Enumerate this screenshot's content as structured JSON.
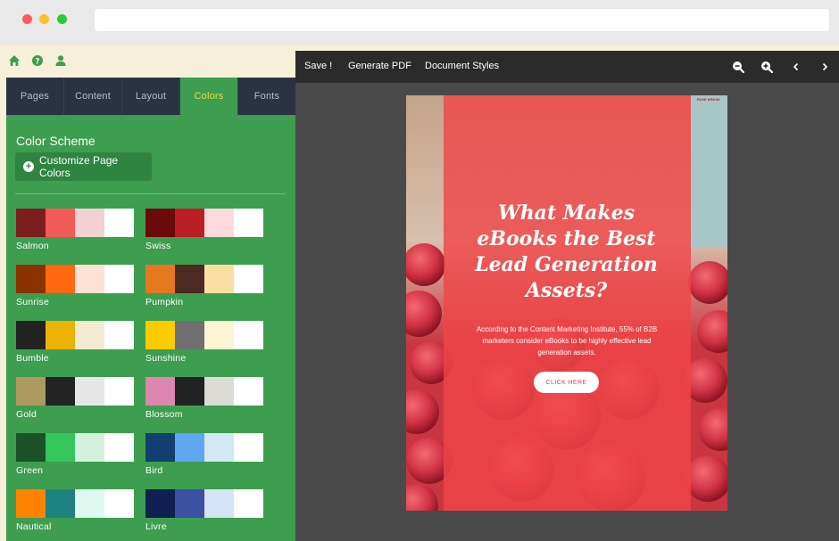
{
  "nav_icons": [
    "home-icon",
    "help-icon",
    "user-icon"
  ],
  "tabs": [
    {
      "label": "Pages"
    },
    {
      "label": "Content"
    },
    {
      "label": "Layout"
    },
    {
      "label": "Colors"
    },
    {
      "label": "Fonts"
    }
  ],
  "active_tab": "Colors",
  "panel": {
    "title": "Color Scheme",
    "customize_label": "Customize Page Colors"
  },
  "schemes": [
    {
      "name": "Salmon",
      "colors": [
        "#7d1e1e",
        "#f25a57",
        "#f1d1d1",
        "#ffffff"
      ]
    },
    {
      "name": "Swiss",
      "colors": [
        "#6b0a0a",
        "#ba1f26",
        "#fcd9dc",
        "#ffffff"
      ]
    },
    {
      "name": "Sunrise",
      "colors": [
        "#8a3200",
        "#ff6a10",
        "#fde1d3",
        "#ffffff"
      ]
    },
    {
      "name": "Pumpkin",
      "colors": [
        "#e5771e",
        "#4a2a22",
        "#fadfa4",
        "#ffffff"
      ]
    },
    {
      "name": "Bumble",
      "colors": [
        "#222222",
        "#eab305",
        "#f3ebcf",
        "#ffffff"
      ]
    },
    {
      "name": "Sunshine",
      "colors": [
        "#fecb02",
        "#6f6f6f",
        "#fcf4d3",
        "#ffffff"
      ]
    },
    {
      "name": "Gold",
      "colors": [
        "#ad9a61",
        "#232323",
        "#e7e7e7",
        "#ffffff"
      ]
    },
    {
      "name": "Blossom",
      "colors": [
        "#dc86b0",
        "#222222",
        "#dcdcd4",
        "#ffffff"
      ]
    },
    {
      "name": "Green",
      "colors": [
        "#1c5128",
        "#34c55c",
        "#d4f1df",
        "#ffffff"
      ]
    },
    {
      "name": "Bird",
      "colors": [
        "#123f70",
        "#5fa7f0",
        "#d2e8f2",
        "#ffffff"
      ]
    },
    {
      "name": "Nautical",
      "colors": [
        "#ff8200",
        "#1d8280",
        "#dff9f0",
        "#ffffff"
      ]
    },
    {
      "name": "Livre",
      "colors": [
        "#0f1f52",
        "#3a52a1",
        "#d5e2f7",
        "#ffffff"
      ]
    }
  ],
  "toolbar": {
    "save_label": "Save !",
    "generate_label": "Generate PDF",
    "styles_label": "Document Styles",
    "icons": [
      "zoom-out-icon",
      "zoom-in-icon",
      "previous-page-icon",
      "next-page-icon"
    ]
  },
  "page": {
    "page_break": "PAGE BREAK",
    "headline_lines": [
      "What Makes",
      "eBooks the Best",
      "Lead Generation",
      "Assets?"
    ],
    "body_lines": [
      "According to the Content Marketing Institute, 55% of B2B",
      "marketers consider eBooks to be highly effective lead",
      "generation assets."
    ],
    "cta_label": "CLICK HERE"
  },
  "colors": {
    "panel_green": "#3d9e4f",
    "tab_bar": "#2b3241",
    "active_tab_text": "#f3d54c",
    "preview_bg": "#4a4a4a",
    "page_red": "#ef4648"
  }
}
